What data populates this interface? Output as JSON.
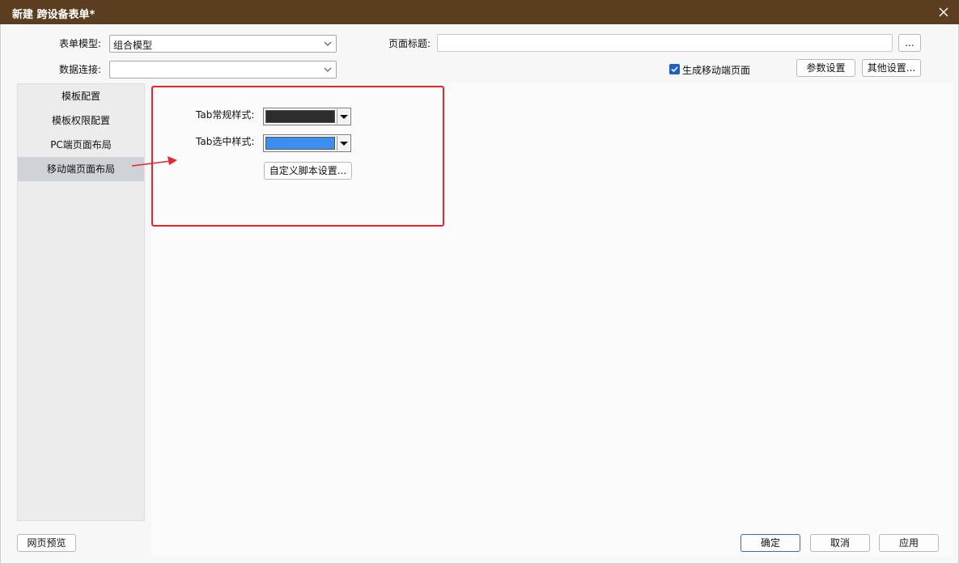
{
  "window": {
    "title": "新建 跨设备表单*"
  },
  "form": {
    "model_label": "表单模型:",
    "model_value": "组合模型",
    "connection_label": "数据连接:",
    "connection_value": "",
    "page_title_label": "页面标题:",
    "page_title_value": "",
    "ellipsis_label": "...",
    "mobile_checkbox_label": "生成移动端页面",
    "mobile_checkbox_checked": true,
    "params_button": "参数设置",
    "other_button": "其他设置..."
  },
  "sidebar": {
    "items": [
      {
        "label": "模板配置",
        "active": false
      },
      {
        "label": "模板权限配置",
        "active": false
      },
      {
        "label": "PC端页面布局",
        "active": false
      },
      {
        "label": "移动端页面布局",
        "active": true
      }
    ]
  },
  "mobile_layout": {
    "tab_normal_label": "Tab常规样式:",
    "tab_normal_color": "#2d2d2d",
    "tab_selected_label": "Tab选中样式:",
    "tab_selected_color": "#3e8ef0",
    "custom_script_button": "自定义脚本设置..."
  },
  "footer": {
    "preview_button": "网页预览",
    "ok_button": "确定",
    "cancel_button": "取消",
    "apply_button": "应用"
  },
  "annotation_color": "#e8262a",
  "titlebar_color": "#5a3e1f"
}
